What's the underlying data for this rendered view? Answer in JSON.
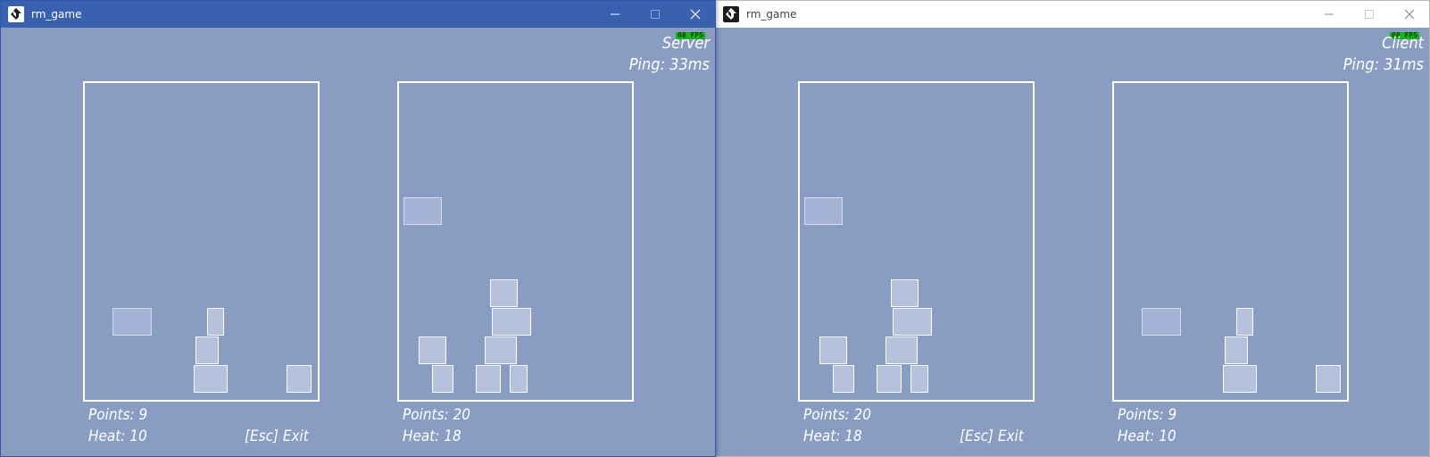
{
  "server_window": {
    "title": "rm_game",
    "fps_badge": "60 FPS",
    "role": "Server",
    "ping": "Ping: 33ms",
    "left_field": {
      "points": "Points: 9",
      "heat": "Heat: 10"
    },
    "right_field": {
      "points": "Points: 20",
      "heat": "Heat: 18"
    },
    "exit_hint": "[Esc] Exit"
  },
  "client_window": {
    "title": "rm_game",
    "fps_badge": "60 FPS",
    "role": "Client",
    "ping": "Ping: 31ms",
    "left_field": {
      "points": "Points: 20",
      "heat": "Heat: 18"
    },
    "right_field": {
      "points": "Points: 9",
      "heat": "Heat: 10"
    },
    "exit_hint": "[Esc] Exit"
  },
  "icons": {
    "app": "game-maker-icon",
    "minimize": "minimize-icon",
    "maximize": "maximize-icon",
    "close": "close-icon"
  },
  "colors": {
    "server_titlebar": "#3a60b0",
    "client_titlebar": "#ffffff",
    "game_background": "#899dc3",
    "block_fill": "#b6c1de",
    "fps_badge": "#19b319"
  }
}
